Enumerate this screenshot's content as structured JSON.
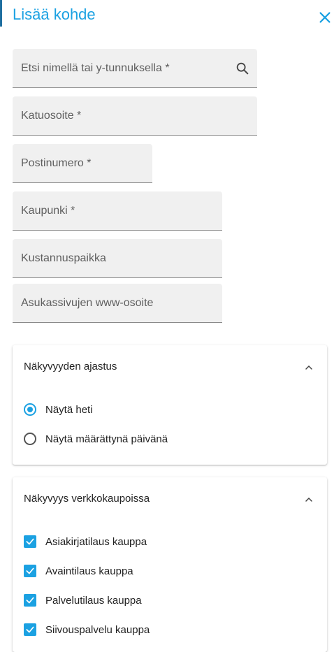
{
  "dialog": {
    "title": "Lisää kohde",
    "accent_color": "#1ba1e2"
  },
  "fields": {
    "search_placeholder": "Etsi nimellä tai y-tunnuksella *",
    "street_placeholder": "Katuosoite *",
    "postal_placeholder": "Postinumero *",
    "city_placeholder": "Kaupunki *",
    "cost_center_placeholder": "Kustannuspaikka",
    "website_placeholder": "Asukassivujen www-osoite"
  },
  "visibility_timing": {
    "title": "Näkyvyyden ajastus",
    "options": [
      {
        "label": "Näytä heti",
        "selected": true
      },
      {
        "label": "Näytä määrättynä päivänä",
        "selected": false
      }
    ]
  },
  "shop_visibility": {
    "title": "Näkyvyys verkkokaupoissa",
    "options": [
      {
        "label": "Asiakirjatilaus kauppa",
        "checked": true
      },
      {
        "label": "Avaintilaus kauppa",
        "checked": true
      },
      {
        "label": "Palvelutilaus kauppa",
        "checked": true
      },
      {
        "label": "Siivouspalvelu kauppa",
        "checked": true
      }
    ]
  }
}
